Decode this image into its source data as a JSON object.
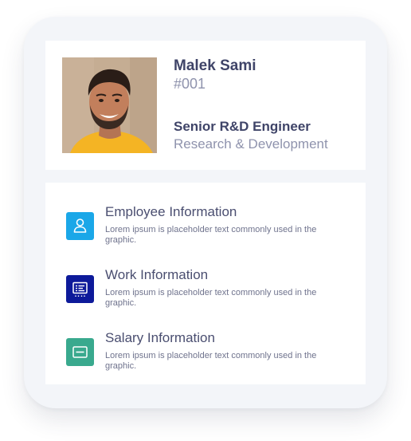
{
  "profile": {
    "name": "Malek Sami",
    "employee_id": "#001",
    "job_title": "Senior R&D Engineer",
    "department": "Research & Development",
    "photo_icon": "employee-photo"
  },
  "sections": [
    {
      "title": "Employee Information",
      "description": "Lorem ipsum is placeholder text commonly used in the graphic.",
      "icon": "user-icon",
      "color": "#1aa7e8"
    },
    {
      "title": "Work Information",
      "description": "Lorem ipsum is placeholder text commonly used in the graphic.",
      "icon": "presentation-board-icon",
      "color": "#0d1a9a"
    },
    {
      "title": "Salary Information",
      "description": "Lorem ipsum is placeholder text commonly used in the graphic.",
      "icon": "wallet-card-icon",
      "color": "#39a98e"
    }
  ]
}
